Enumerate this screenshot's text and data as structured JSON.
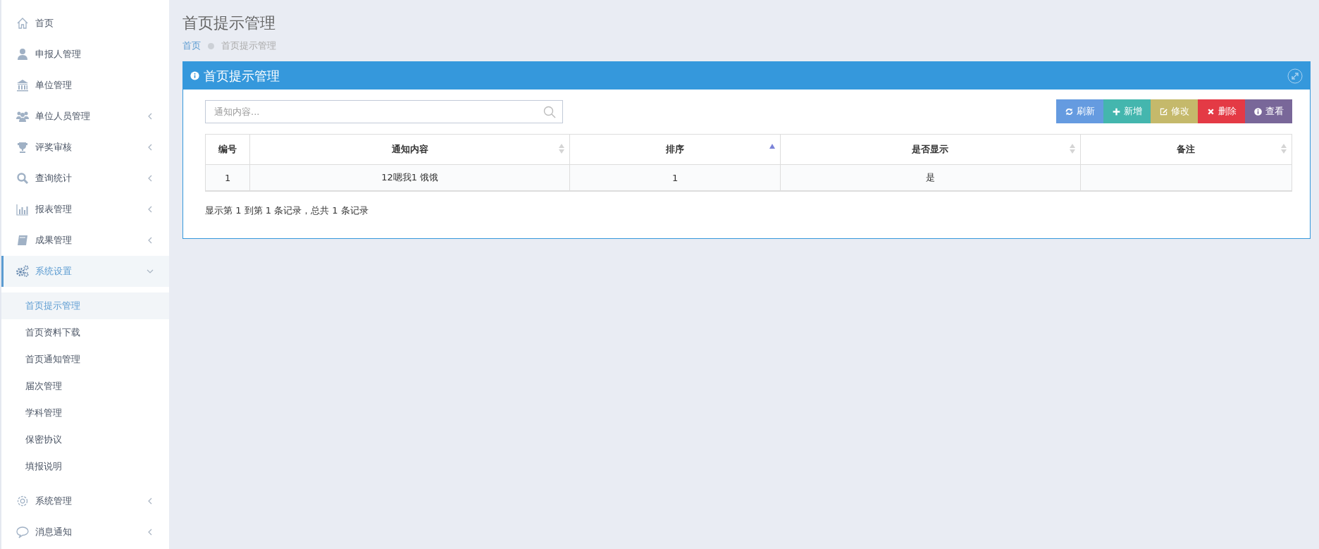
{
  "sidebar": {
    "items": [
      {
        "label": "首页",
        "selected": false
      },
      {
        "label": "申报人管理",
        "selected": false
      },
      {
        "label": "单位管理",
        "selected": false
      },
      {
        "label": "单位人员管理",
        "selected": false,
        "expanded": false
      },
      {
        "label": "评奖审核",
        "selected": false,
        "expanded": false
      },
      {
        "label": "查询统计",
        "selected": false,
        "expanded": false
      },
      {
        "label": "报表管理",
        "selected": false,
        "expanded": false
      },
      {
        "label": "成果管理",
        "selected": false,
        "expanded": false
      },
      {
        "label": "系统设置",
        "selected": true,
        "expanded": true,
        "children": [
          {
            "label": "首页提示管理",
            "selected": true
          },
          {
            "label": "首页资料下载",
            "selected": false
          },
          {
            "label": "首页通知管理",
            "selected": false
          },
          {
            "label": "届次管理",
            "selected": false
          },
          {
            "label": "学科管理",
            "selected": false
          },
          {
            "label": "保密协议",
            "selected": false
          },
          {
            "label": "填报说明",
            "selected": false
          }
        ]
      },
      {
        "label": "系统管理",
        "selected": false,
        "expanded": false
      },
      {
        "label": "消息通知",
        "selected": false,
        "expanded": false
      }
    ]
  },
  "page_title": "首页提示管理",
  "breadcrumb": [
    "首页",
    "首页提示管理"
  ],
  "panel": {
    "title": "首页提示管理",
    "search": {
      "placeholder": "通知内容..."
    },
    "buttons": [
      {
        "label": "刷新",
        "color": "#659be0"
      },
      {
        "label": "新增",
        "color": "#44b6ae"
      },
      {
        "label": "修改",
        "color": "#c5b96b"
      },
      {
        "label": "删除",
        "color": "#e43a45"
      },
      {
        "label": "查看",
        "color": "#796799"
      }
    ],
    "table": {
      "columns": [
        {
          "label": "编号",
          "sortable": false
        },
        {
          "label": "通知内容",
          "sortable": true,
          "sorted": false
        },
        {
          "label": "排序",
          "sortable": true,
          "sorted": true
        },
        {
          "label": "是否显示",
          "sortable": true,
          "sorted": false
        },
        {
          "label": "备注",
          "sortable": true,
          "sorted": false
        }
      ],
      "rows": [
        [
          "1",
          "12嗯我1 饿饿",
          "1",
          "是",
          ""
        ]
      ]
    },
    "footer": "显示第 1 到第 1 条记录，总共 1 条记录"
  }
}
